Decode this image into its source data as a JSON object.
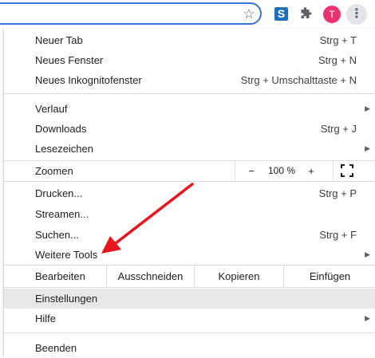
{
  "toolbar": {
    "icons": [
      "bookmark-star-icon",
      "extension-s-icon",
      "extensions-puzzle-icon",
      "profile-avatar",
      "menu-kebab-icon"
    ],
    "avatar_letter": "T",
    "accent_color": "#3a73d6",
    "avatar_color": "#e8336e"
  },
  "menu": {
    "group1": [
      {
        "label": "Neuer Tab",
        "shortcut": "Strg + T"
      },
      {
        "label": "Neues Fenster",
        "shortcut": "Strg + N"
      },
      {
        "label": "Neues Inkognitofenster",
        "shortcut": "Strg + Umschalttaste + N"
      }
    ],
    "group2": [
      {
        "label": "Verlauf",
        "submenu": true
      },
      {
        "label": "Downloads",
        "shortcut": "Strg + J"
      },
      {
        "label": "Lesezeichen",
        "submenu": true
      }
    ],
    "zoom": {
      "label": "Zoomen",
      "minus": "−",
      "value": "100 %",
      "plus": "+"
    },
    "group3": [
      {
        "label": "Drucken...",
        "shortcut": "Strg + P"
      },
      {
        "label": "Streamen..."
      },
      {
        "label": "Suchen...",
        "shortcut": "Strg + F"
      },
      {
        "label": "Weitere Tools",
        "submenu": true
      }
    ],
    "edit": {
      "label": "Bearbeiten",
      "cut": "Ausschneiden",
      "copy": "Kopieren",
      "paste": "Einfügen"
    },
    "group4": [
      {
        "label": "Einstellungen",
        "highlighted": true
      },
      {
        "label": "Hilfe",
        "submenu": true
      }
    ],
    "exit": {
      "label": "Beenden"
    }
  },
  "annotation": {
    "type": "red-arrow",
    "color": "#e8141e",
    "points_to": "Weitere Tools"
  }
}
